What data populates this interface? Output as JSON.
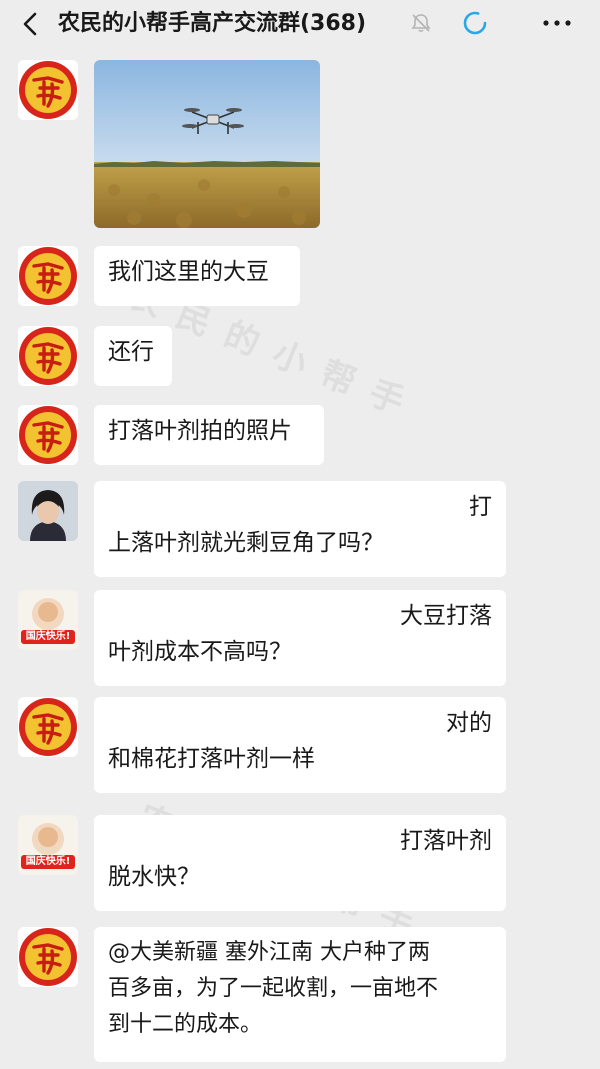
{
  "header": {
    "title": "农民的小帮手高产交流群(368)",
    "back_icon": "chevron-left-icon",
    "mute_icon": "bell-muted-icon",
    "loading_icon": "loading-ring-icon",
    "more_icon": "more-horizontal-icon",
    "accent_color": "#2aa7e8"
  },
  "watermark": {
    "text1": "农民的小帮手",
    "text2": "农民的小帮手",
    "text3": "农民的小帮手"
  },
  "messages": [
    {
      "sender_avatar": "red-seal-avatar",
      "type": "image",
      "image_desc": "drone-over-soybean-field"
    },
    {
      "sender_avatar": "red-seal-avatar",
      "type": "text",
      "lines": [
        "我们这里的大豆"
      ]
    },
    {
      "sender_avatar": "red-seal-avatar",
      "type": "text",
      "lines": [
        "还行"
      ]
    },
    {
      "sender_avatar": "red-seal-avatar",
      "type": "text",
      "lines": [
        "打落叶剂拍的照片"
      ]
    },
    {
      "sender_avatar": "woman-photo-avatar",
      "type": "text",
      "lines": [
        "打",
        "上落叶剂就光剩豆角了吗？"
      ]
    },
    {
      "sender_avatar": "national-day-avatar",
      "avatar_badge": "国庆快乐!",
      "type": "text",
      "lines": [
        "大豆打落",
        "叶剂成本不高吗？"
      ]
    },
    {
      "sender_avatar": "red-seal-avatar",
      "type": "text",
      "lines": [
        "对的",
        "和棉花打落叶剂一样"
      ]
    },
    {
      "sender_avatar": "national-day-avatar",
      "avatar_badge": "国庆快乐!",
      "type": "text",
      "lines": [
        "打落叶剂",
        "脱水快？"
      ]
    },
    {
      "sender_avatar": "red-seal-avatar",
      "type": "text",
      "lines": [
        "@大美新疆  塞外江南  大户种了两",
        "百多亩，为了一起收割，一亩地不",
        "到十二的成本。"
      ]
    }
  ]
}
